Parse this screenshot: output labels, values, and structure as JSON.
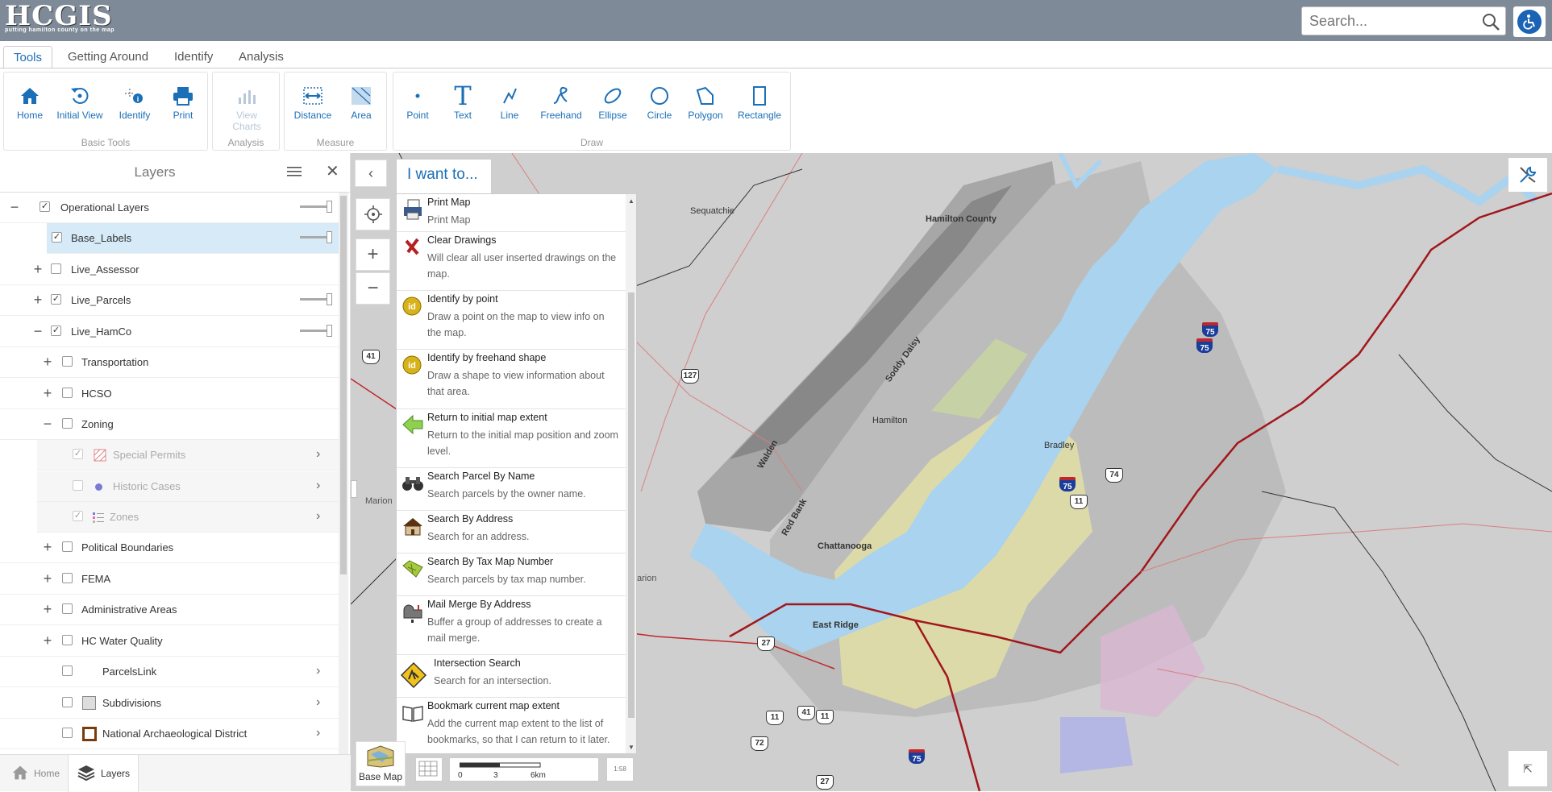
{
  "header": {
    "logo_title": "HCGIS",
    "logo_subtitle": "putting hamilton county on the map",
    "search_placeholder": "Search..."
  },
  "tabs": [
    {
      "label": "Tools",
      "active": true
    },
    {
      "label": "Getting Around"
    },
    {
      "label": "Identify"
    },
    {
      "label": "Analysis"
    }
  ],
  "ribbon": {
    "groups": {
      "basic_tools": "Basic Tools",
      "analysis": "Analysis",
      "measure": "Measure",
      "draw": "Draw"
    },
    "tools": {
      "home": "Home",
      "initial_view": "Initial View",
      "identify": "Identify",
      "print": "Print",
      "view_charts": "View Charts",
      "distance": "Distance",
      "area": "Area",
      "point": "Point",
      "text": "Text",
      "text_glyph": "T",
      "line": "Line",
      "freehand": "Freehand",
      "ellipse": "Ellipse",
      "circle": "Circle",
      "polygon": "Polygon",
      "rectangle": "Rectangle"
    }
  },
  "layers_panel": {
    "title": "Layers",
    "rows": [
      {
        "name": "Operational Layers",
        "checked": true,
        "expander": "minus"
      },
      {
        "name": "Base_Labels",
        "checked": true,
        "selected": true
      },
      {
        "name": "Live_Assessor",
        "checked": false,
        "expander": "plus"
      },
      {
        "name": "Live_Parcels",
        "checked": true,
        "expander": "plus"
      },
      {
        "name": "Live_HamCo",
        "checked": true,
        "expander": "minus"
      },
      {
        "name": "Transportation",
        "checked": false,
        "expander": "plus"
      },
      {
        "name": "HCSO",
        "checked": false,
        "expander": "plus"
      },
      {
        "name": "Zoning",
        "checked": false,
        "expander": "minus"
      },
      {
        "name": "Special Permits",
        "checked": true,
        "dim": true
      },
      {
        "name": "Historic Cases",
        "checked": false,
        "dim": true
      },
      {
        "name": "Zones",
        "checked": true,
        "dim": true
      },
      {
        "name": "Political Boundaries",
        "checked": false,
        "expander": "plus"
      },
      {
        "name": "FEMA",
        "checked": false,
        "expander": "plus"
      },
      {
        "name": "Administrative Areas",
        "checked": false,
        "expander": "plus"
      },
      {
        "name": "HC Water Quality",
        "checked": false,
        "expander": "plus"
      },
      {
        "name": "ParcelsLink",
        "checked": false
      },
      {
        "name": "Subdivisions",
        "checked": false
      },
      {
        "name": "National Archaeological District",
        "checked": false
      }
    ]
  },
  "bottom_tabs": {
    "home": "Home",
    "layers": "Layers"
  },
  "i_want_to": {
    "title": "I want to...",
    "items": [
      {
        "title": "Print Map",
        "desc": "Print Map",
        "icon": "printer-icon"
      },
      {
        "title": "Clear Drawings",
        "desc": "Will clear all user inserted drawings on the map.",
        "icon": "clear-x-icon"
      },
      {
        "title": "Identify by point",
        "desc": "Draw a point on the map to view info on the map.",
        "icon": "id-badge-icon"
      },
      {
        "title": "Identify by freehand shape",
        "desc": "Draw a shape to view information about that area.",
        "icon": "id-badge-icon"
      },
      {
        "title": "Return to initial map extent",
        "desc": "Return to the initial map position and zoom level.",
        "icon": "green-arrow-icon"
      },
      {
        "title": "Search Parcel By Name",
        "desc": "Search parcels by the owner name.",
        "icon": "binoculars-icon"
      },
      {
        "title": "Search By Address",
        "desc": "Search for an address.",
        "icon": "house-icon"
      },
      {
        "title": "Search By Tax Map Number",
        "desc": "Search parcels by tax map number.",
        "icon": "map-icon"
      },
      {
        "title": "Mail Merge By Address",
        "desc": "Buffer a group of addresses to create a mail merge.",
        "icon": "mailbox-icon"
      },
      {
        "title": "Intersection Search",
        "desc": "Search for an intersection.",
        "icon": "road-sign-icon"
      },
      {
        "title": "Bookmark current map extent",
        "desc": "Add the current map extent to the list of bookmarks, so that I can return to it later.",
        "icon": "book-icon"
      }
    ]
  },
  "map": {
    "basemap_label": "Base Map",
    "scale": {
      "ticks": [
        "0",
        "3",
        "6km"
      ]
    },
    "labels": [
      "Sequatchie",
      "Hamilton County",
      "Soddy Daisy",
      "Hamilton",
      "Walden",
      "Red Bank",
      "Chattanooga",
      "East Ridge",
      "Bradley",
      "Marion",
      "arion"
    ],
    "shields": [
      "41",
      "127",
      "27",
      "11",
      "41",
      "11",
      "72",
      "27",
      "74",
      "11"
    ],
    "interstates": [
      "75",
      "75",
      "75",
      "75"
    ],
    "scale_small": "1:58"
  }
}
